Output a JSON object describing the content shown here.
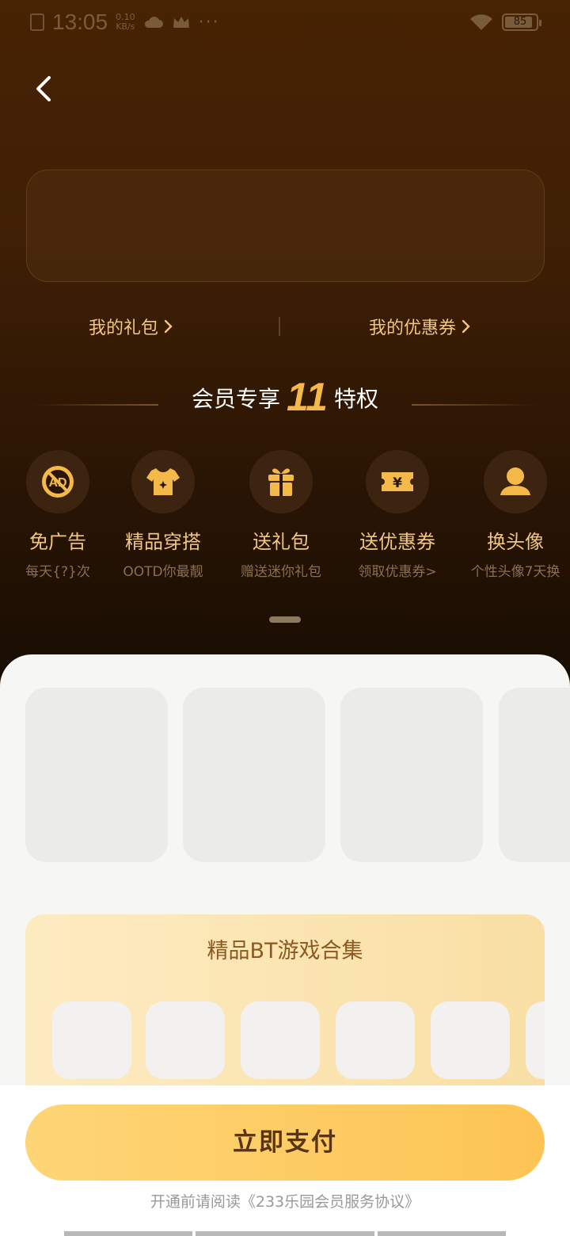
{
  "status_bar": {
    "time": "13:05",
    "speed_value": "0.10",
    "speed_unit": "KB/s",
    "more": "···",
    "battery": "85"
  },
  "links": {
    "gift": "我的礼包",
    "coupon": "我的优惠券"
  },
  "privileges_title": {
    "prefix": "会员专享",
    "count": "11",
    "suffix": "特权"
  },
  "privileges": [
    {
      "name": "免广告",
      "sub": "每天{?}次",
      "icon": "no-ad-icon"
    },
    {
      "name": "精品穿搭",
      "sub": "OOTD你最靓",
      "icon": "tshirt-icon"
    },
    {
      "name": "送礼包",
      "sub": "赠送迷你礼包",
      "icon": "gift-icon"
    },
    {
      "name": "送优惠券",
      "sub": "领取优惠券>",
      "icon": "coupon-icon"
    },
    {
      "name": "换头像",
      "sub": "个性头像7天换",
      "icon": "avatar-icon"
    }
  ],
  "bt_section": {
    "title": "精品BT游戏合集"
  },
  "pay": {
    "button": "立即支付",
    "agreement": "开通前请阅读《233乐园会员服务协议》"
  },
  "colors": {
    "accent": "#f5b94a",
    "gold_text": "#f1c680",
    "pay_button": "#fdc454"
  }
}
